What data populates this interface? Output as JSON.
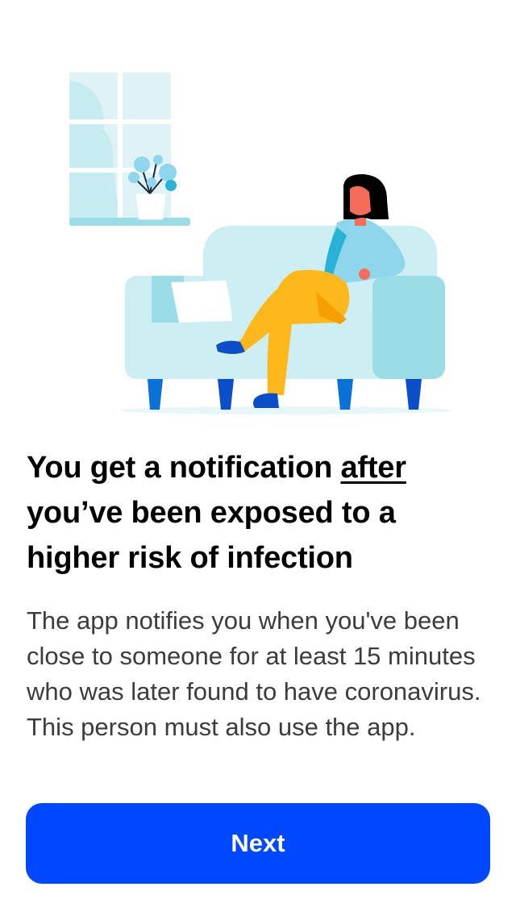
{
  "illustration": {
    "icon": "person-on-sofa-illustration",
    "colors": {
      "window": "#dff3f7",
      "sofa": "#cdeef3",
      "sofa_arm": "#9adde6",
      "skin": "#f56d5a",
      "shirt": "#8ed6ea",
      "pants": "#ffb81c",
      "shoes": "#0a4fc8",
      "hair": "#000000"
    }
  },
  "onboarding": {
    "headline_part1": "You get a notification ",
    "headline_emphasis": "after",
    "headline_part2": " you’ve been exposed to a higher risk of infection",
    "body": "The app notifies you when you've been close to someone for at least 15 minutes who was later found to have coronavirus. This person must also use the app.",
    "next_label": "Next"
  },
  "colors": {
    "button_background": "#0048ff",
    "button_text": "#ffffff",
    "headline": "#000000",
    "body_text": "#3c3c3c"
  }
}
